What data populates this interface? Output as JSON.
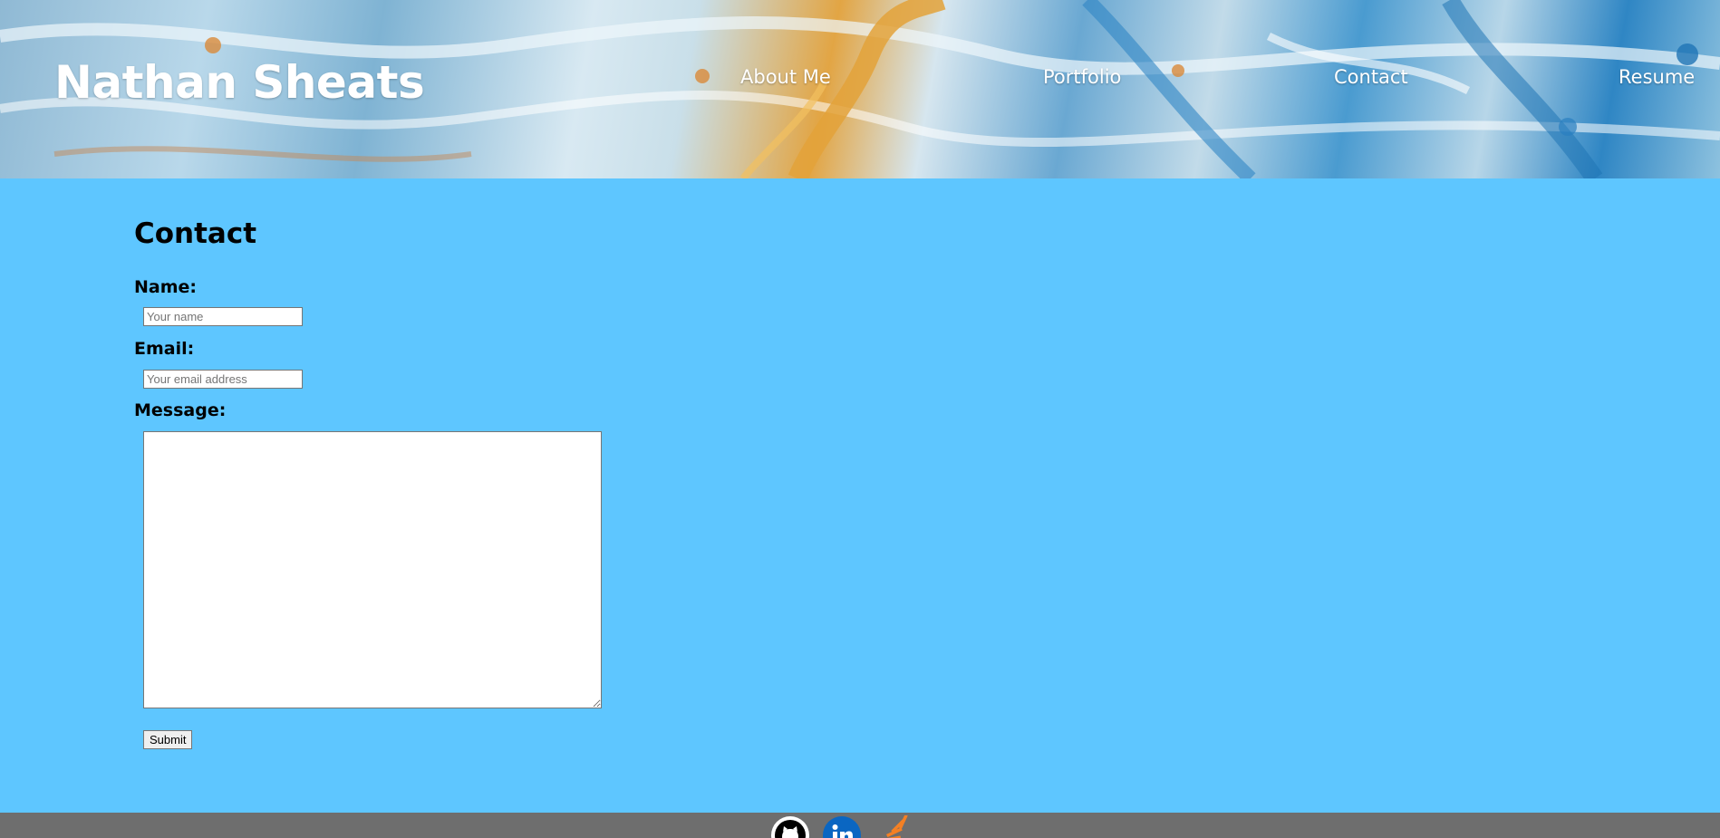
{
  "header": {
    "site_title": "Nathan Sheats",
    "nav": [
      {
        "label": "About Me"
      },
      {
        "label": "Portfolio"
      },
      {
        "label": "Contact"
      },
      {
        "label": "Resume"
      }
    ]
  },
  "contact": {
    "title": "Contact",
    "name_label": "Name:",
    "name_placeholder": "Your name",
    "email_label": "Email:",
    "email_placeholder": "Your email address",
    "message_label": "Message:",
    "message_value": "",
    "submit_label": "Submit"
  },
  "footer": {
    "social": [
      {
        "icon": "github-icon"
      },
      {
        "icon": "linkedin-icon"
      },
      {
        "icon": "stackoverflow-icon"
      }
    ]
  },
  "colors": {
    "page_background": "#5ec6ff",
    "footer_background": "#6e6e6e",
    "header_text": "#ffffff",
    "linkedin_blue": "#0a66c2",
    "stackoverflow_orange": "#f48024"
  }
}
